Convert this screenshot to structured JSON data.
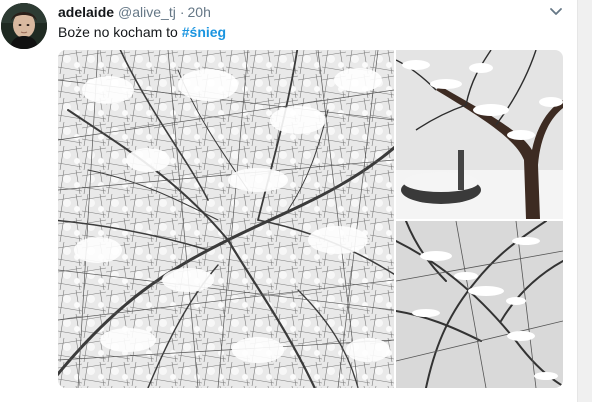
{
  "tweet": {
    "display_name": "adelaide",
    "handle": "@alive_tj",
    "separator": "·",
    "time": "20h",
    "text_prefix": "Boże no kocham to ",
    "hashtag": "#śnieg",
    "avatar_icon": "profile-avatar",
    "caret_icon": "chevron-down-icon"
  },
  "media": {
    "photos": [
      {
        "subject": "snow-covered branches"
      },
      {
        "subject": "snowy tree in garden"
      },
      {
        "subject": "snow on branches close-up"
      }
    ]
  },
  "colors": {
    "text": "#14171a",
    "secondary": "#657786",
    "hashtag": "#1b95e0"
  }
}
